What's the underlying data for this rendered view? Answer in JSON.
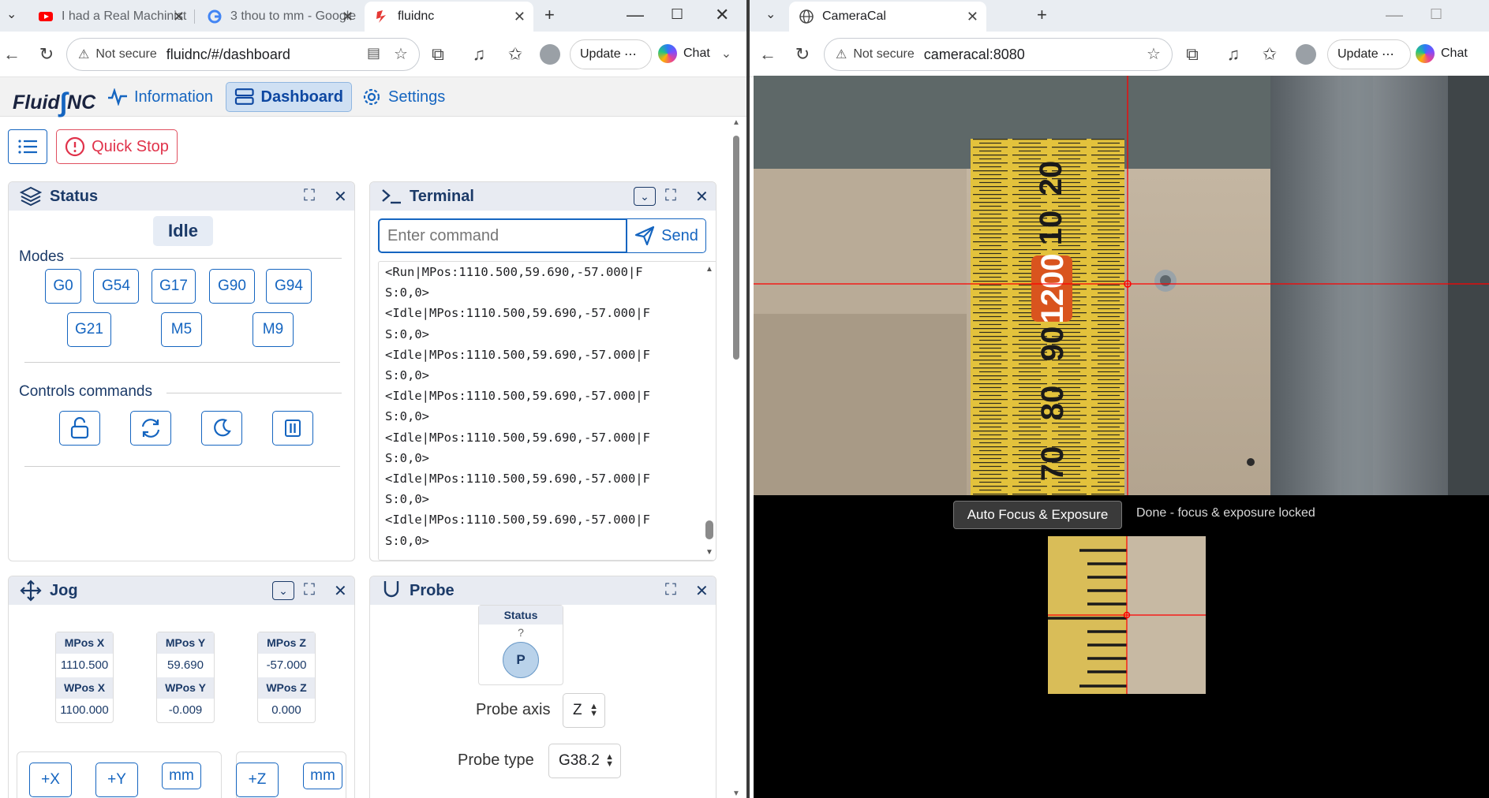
{
  "left_browser": {
    "tabs": [
      {
        "title": "I had a Real Machinist",
        "icon": "youtube-icon"
      },
      {
        "title": "3 thou to mm - Google",
        "icon": "google-icon"
      },
      {
        "title": "fluidnc",
        "icon": "fluidnc-icon",
        "active": true
      }
    ],
    "address": {
      "warning": "Not secure",
      "url": "fluidnc/#/dashboard"
    },
    "update_label": "Update",
    "chat_label": "Chat"
  },
  "right_browser": {
    "tabs": [
      {
        "title": "CameraCal",
        "icon": "globe-icon",
        "active": true
      }
    ],
    "address": {
      "warning": "Not secure",
      "url": "cameracal:8080"
    },
    "update_label": "Update",
    "chat_label": "Chat"
  },
  "fluidnc": {
    "brand": {
      "left": "Fluid",
      "right": "NC"
    },
    "nav": {
      "information": "Information",
      "dashboard": "Dashboard",
      "settings": "Settings"
    },
    "quick_stop": "Quick Stop",
    "status_panel": {
      "title": "Status",
      "state": "Idle",
      "modes_label": "Modes",
      "modes": [
        "G0",
        "G54",
        "G17",
        "G90",
        "G94",
        "G21",
        "M5",
        "M9"
      ],
      "controls_label": "Controls commands"
    },
    "terminal_panel": {
      "title": "Terminal",
      "placeholder": "Enter command",
      "send_label": "Send",
      "lines": [
        "<Run|MPos:1110.500,59.690,-57.000|F",
        "S:0,0>",
        "<Idle|MPos:1110.500,59.690,-57.000|F",
        "S:0,0>",
        "<Idle|MPos:1110.500,59.690,-57.000|F",
        "S:0,0>",
        "<Idle|MPos:1110.500,59.690,-57.000|F",
        "S:0,0>",
        "<Idle|MPos:1110.500,59.690,-57.000|F",
        "S:0,0>",
        "<Idle|MPos:1110.500,59.690,-57.000|F",
        "S:0,0>",
        "<Idle|MPos:1110.500,59.690,-57.000|F",
        "S:0,0>"
      ]
    },
    "jog_panel": {
      "title": "Jog",
      "positions": [
        {
          "mpos_label": "MPos X",
          "mpos": "1110.500",
          "wpos_label": "WPos X",
          "wpos": "1100.000"
        },
        {
          "mpos_label": "MPos Y",
          "mpos": "59.690",
          "wpos_label": "WPos Y",
          "wpos": "-0.009"
        },
        {
          "mpos_label": "MPos Z",
          "mpos": "-57.000",
          "wpos_label": "WPos Z",
          "wpos": "0.000"
        }
      ],
      "buttons": {
        "plus_x": "+X",
        "plus_y": "+Y",
        "unit_xy": "mm",
        "plus_z": "+Z",
        "unit_z": "mm"
      }
    },
    "probe_panel": {
      "title": "Probe",
      "status_label": "Status",
      "status_value": "?",
      "indicator": "P",
      "axis_label": "Probe axis",
      "axis_value": "Z",
      "type_label": "Probe type",
      "type_value": "G38.2"
    }
  },
  "cameracal": {
    "autofocus_button": "Auto Focus & Exposure",
    "status_text": "Done - focus & exposure locked",
    "tape_numbers": [
      "20",
      "10",
      "1200",
      "90",
      "80",
      "70"
    ]
  },
  "colors": {
    "accent": "#1565c0",
    "stop": "#e0324a",
    "crosshair": "#ff0000",
    "tape": "#e8c43a"
  }
}
